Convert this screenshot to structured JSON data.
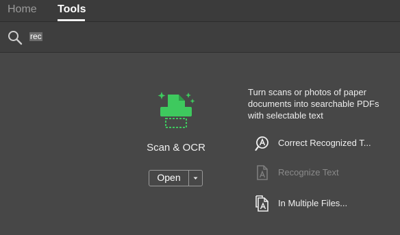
{
  "tabs": [
    {
      "label": "Home",
      "active": false
    },
    {
      "label": "Tools",
      "active": true
    }
  ],
  "search": {
    "value": "rec",
    "icon": "search-icon"
  },
  "tool": {
    "name": "Scan & OCR",
    "icon": "scan-ocr-icon",
    "accent_color": "#3ec95e",
    "open_label": "Open",
    "description": "Turn scans or photos of paper documents into searchable PDFs with selectable text"
  },
  "actions": [
    {
      "label": "Correct Recognized T...",
      "icon": "correct-recognized-text-icon",
      "enabled": true
    },
    {
      "label": "Recognize Text",
      "icon": "recognize-text-icon",
      "enabled": false
    },
    {
      "label": "In Multiple Files...",
      "icon": "multiple-files-icon",
      "enabled": true
    }
  ]
}
